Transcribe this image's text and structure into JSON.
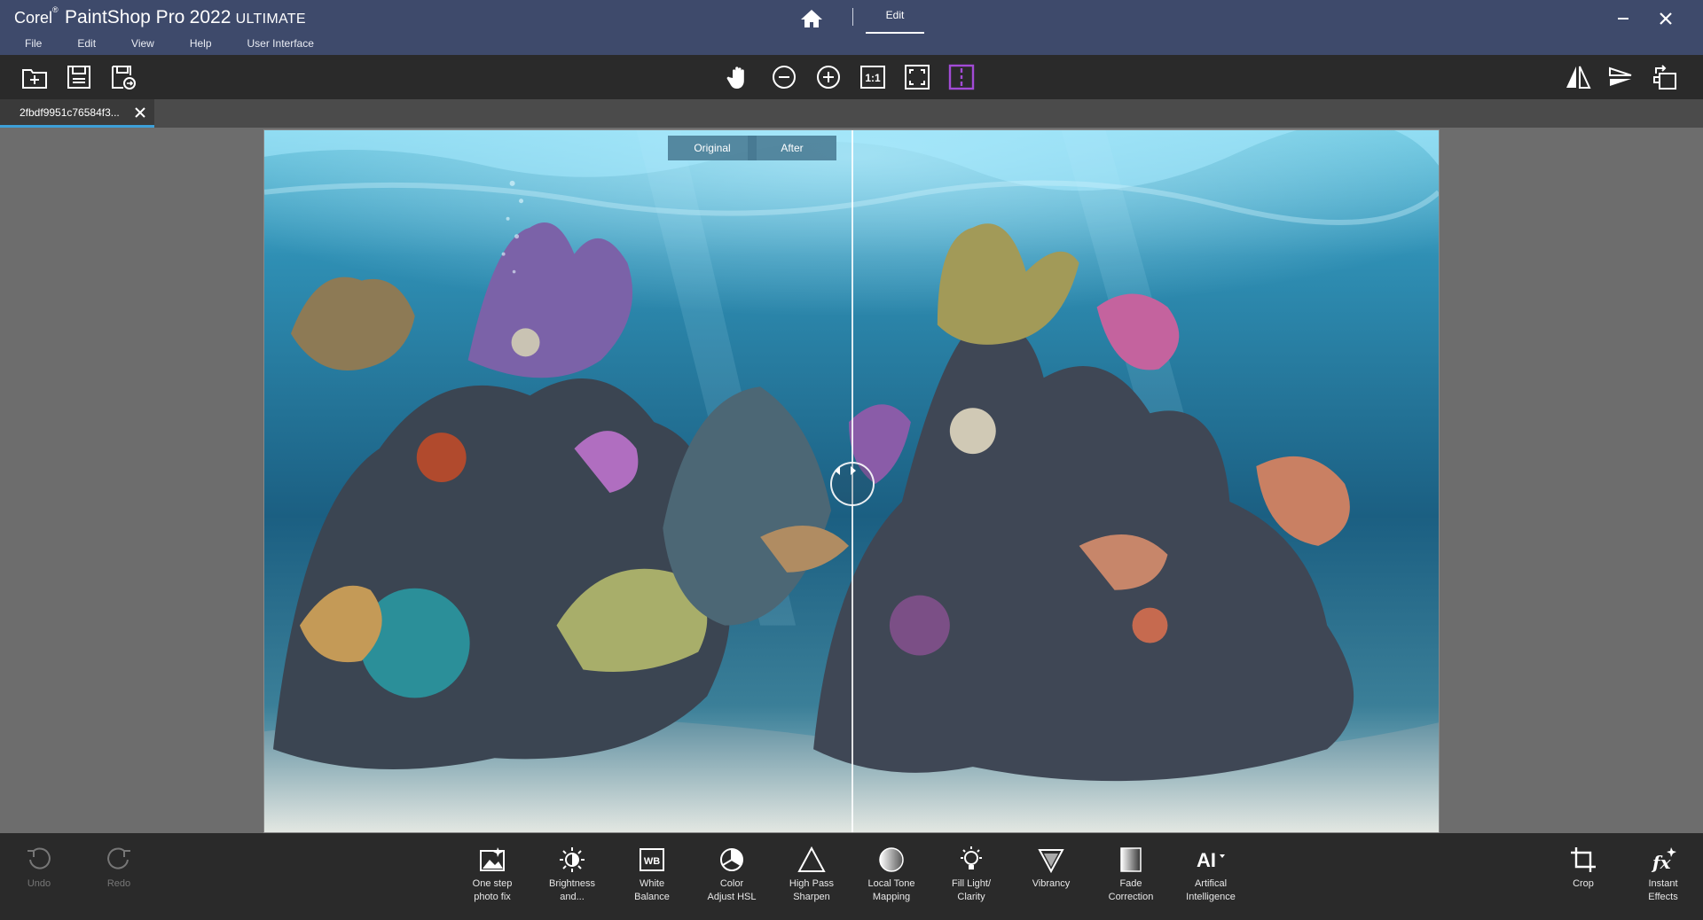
{
  "app": {
    "brand": "Corel",
    "product": "PaintShop Pro",
    "year": "2022",
    "edition": "ULTIMATE"
  },
  "menu": [
    "File",
    "Edit",
    "View",
    "Help",
    "User Interface"
  ],
  "workspace_tab": "Edit",
  "toolbar": {
    "left_icons": [
      "new-file-icon",
      "save-icon",
      "save-as-icon"
    ],
    "center_icons": [
      "pan-hand-icon",
      "zoom-out-icon",
      "zoom-in-icon",
      "actual-size-icon",
      "fit-to-window-icon",
      "compare-split-icon"
    ],
    "right_icons": [
      "flip-horizontal-icon",
      "flip-vertical-icon",
      "rotate-icon"
    ],
    "actual_size_label": "1:1"
  },
  "document": {
    "tab_name": "2fbdf9951c76584f3..."
  },
  "compare": {
    "original_label": "Original",
    "after_label": "After"
  },
  "history": {
    "undo_label": "Undo",
    "redo_label": "Redo"
  },
  "adjustments": [
    {
      "line1": "One step",
      "line2": "photo fix",
      "icon": "photo-fix-icon"
    },
    {
      "line1": "Brightness",
      "line2": "and...",
      "icon": "brightness-icon"
    },
    {
      "line1": "White",
      "line2": "Balance",
      "icon": "white-balance-icon"
    },
    {
      "line1": "Color",
      "line2": "Adjust HSL",
      "icon": "color-hsl-icon"
    },
    {
      "line1": "High Pass",
      "line2": "Sharpen",
      "icon": "high-pass-icon"
    },
    {
      "line1": "Local Tone",
      "line2": "Mapping",
      "icon": "local-tone-icon"
    },
    {
      "line1": "Fill Light/",
      "line2": "Clarity",
      "icon": "fill-light-icon"
    },
    {
      "line1": "Vibrancy",
      "line2": "",
      "icon": "vibrancy-icon"
    },
    {
      "line1": "Fade",
      "line2": "Correction",
      "icon": "fade-correction-icon"
    },
    {
      "line1": "Artifical",
      "line2": "Intelligence",
      "icon": "ai-icon"
    }
  ],
  "wb_glyph": "WB",
  "ai_glyph": "AI",
  "fx_glyph": "fx",
  "crop_label": "Crop",
  "instant_effects": {
    "line1": "Instant",
    "line2": "Effects"
  },
  "colors": {
    "titlebar": "#3e4a6b",
    "toolbar": "#2a2a2a",
    "accent_tab": "#3da0d8",
    "compare_active": "#a24bd6"
  }
}
